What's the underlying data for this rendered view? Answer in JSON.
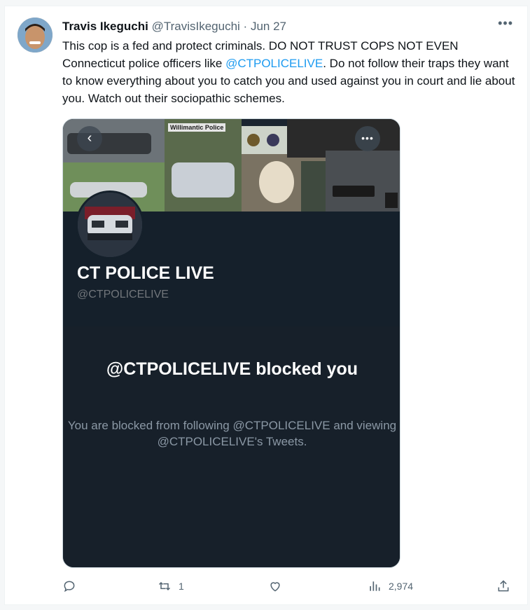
{
  "tweet": {
    "author": {
      "name": "Travis Ikeguchi",
      "handle": "@TravisIkeguchi",
      "separator": "·",
      "date": "Jun 27"
    },
    "text_before": "This cop is a fed and protect criminals. DO NOT TRUST COPS NOT EVEN Connecticut police officers like ",
    "mention": "@CTPOLICELIVE",
    "text_after": ". Do not follow their traps they want to know everything about you to catch you and used against you in court and lie about you. Watch out their sociopathic schemes.",
    "more_icon": "more-horizontal-icon"
  },
  "media": {
    "banner_label": "Willimantic Police",
    "profile_name": "CT POLICE LIVE",
    "profile_handle": "@CTPOLICELIVE",
    "blocked_title": "@CTPOLICELIVE blocked you",
    "blocked_desc": "You are blocked from following @CTPOLICELIVE and viewing @CTPOLICELIVE's Tweets.",
    "colors": {
      "background": "#15202b",
      "text": "#ffffff",
      "muted": "#8b98a5"
    }
  },
  "actions": {
    "reply": {
      "icon": "reply-icon",
      "count": ""
    },
    "retweet": {
      "icon": "retweet-icon",
      "count": "1"
    },
    "like": {
      "icon": "heart-icon",
      "count": ""
    },
    "views": {
      "icon": "views-icon",
      "count": "2,974"
    },
    "share": {
      "icon": "share-icon"
    }
  },
  "colors": {
    "accent": "#1d9bf0",
    "secondary_text": "#536471"
  }
}
